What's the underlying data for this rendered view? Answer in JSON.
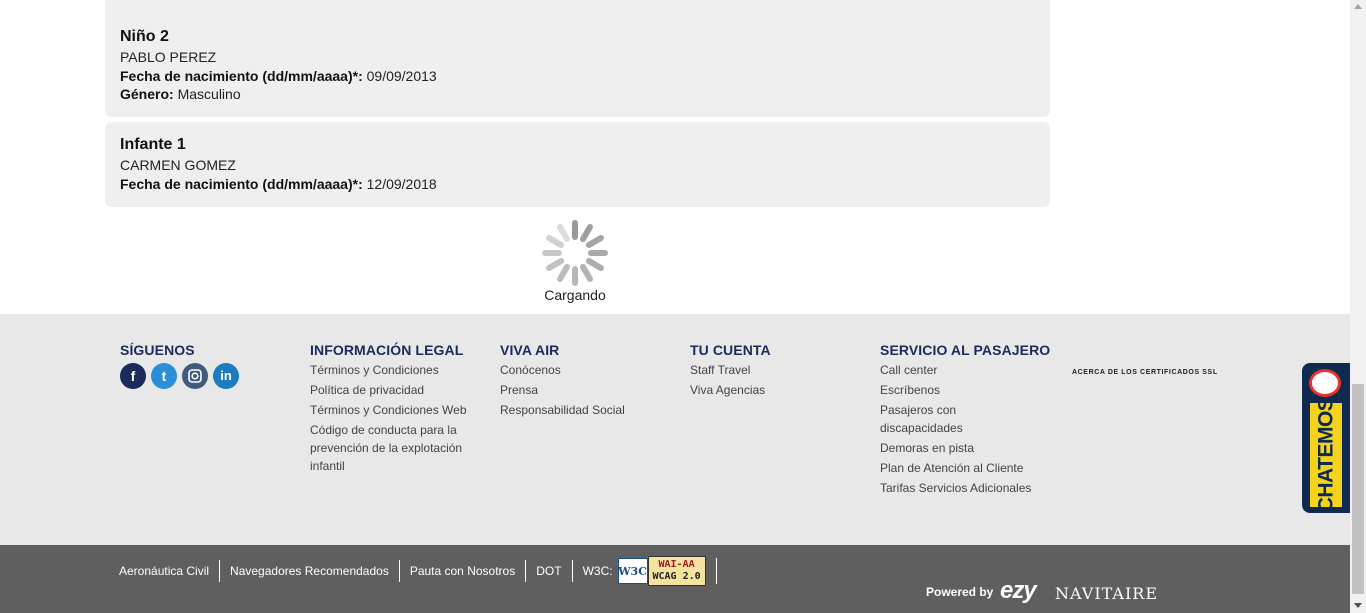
{
  "passengers": [
    {
      "title": "Niño 2",
      "name": "PABLO PEREZ",
      "dob_label": "Fecha de nacimiento (dd/mm/aaaa)*:",
      "dob_value": "09/09/2013",
      "gender_label": "Género:",
      "gender_value": "Masculino"
    },
    {
      "title": "Infante 1",
      "name": "CARMEN GOMEZ",
      "dob_label": "Fecha de nacimiento (dd/mm/aaaa)*:",
      "dob_value": "12/09/2018"
    }
  ],
  "loader": {
    "text": "Cargando"
  },
  "footer": {
    "social": {
      "heading": "SÍGUENOS",
      "icons": [
        "facebook-icon",
        "twitter-icon",
        "instagram-icon",
        "linkedin-icon"
      ],
      "colors": [
        "#1a2b5c",
        "#2a8fd8",
        "#3f5a7a",
        "#1e7bbf"
      ]
    },
    "legal": {
      "heading": "INFORMACIÓN LEGAL",
      "links": [
        "Términos y Condiciones",
        "Política de privacidad",
        "Términos y Condiciones Web",
        "Código de conducta para la prevención de la explotación infantil"
      ]
    },
    "viva_air": {
      "heading": "VIVA AIR",
      "links": [
        "Conócenos",
        "Prensa",
        "Responsabilidad Social"
      ]
    },
    "account": {
      "heading": "TU CUENTA",
      "links": [
        "Staff Travel",
        "Viva Agencias"
      ]
    },
    "service": {
      "heading": "SERVICIO AL PASAJERO",
      "links": [
        "Call center",
        "Escríbenos",
        "Pasajeros con discapacidades",
        "Demoras en pista",
        "Plan de Atención al Cliente",
        "Tarifas Servicios Adicionales"
      ]
    },
    "ssl_text": "ACERCA DE LOS CERTIFICADOS SSL"
  },
  "chat": {
    "label": "CHATEMOS"
  },
  "bottom_bar": {
    "links": [
      "Aeronáutica Civil",
      "Navegadores Recomendados",
      "Pauta con Nosotros",
      "DOT"
    ],
    "w3c_label": "W3C:",
    "w3c_logo_text": "W3C",
    "wcag_line1": "WAI-AA",
    "wcag_line2": "WCAG 2.0",
    "powered_by": "Powered by",
    "ezy_logo": "ezy",
    "navitaire_logo": "NAVITAIRE"
  },
  "colors": {
    "heading_navy": "#1a2b5c",
    "card_bg": "#efefef",
    "footer_bg": "#e8e8e8",
    "bottom_bar_bg": "#5f5f5f",
    "chat_bg": "#0f2a4f",
    "chat_yellow": "#f5d21b"
  }
}
